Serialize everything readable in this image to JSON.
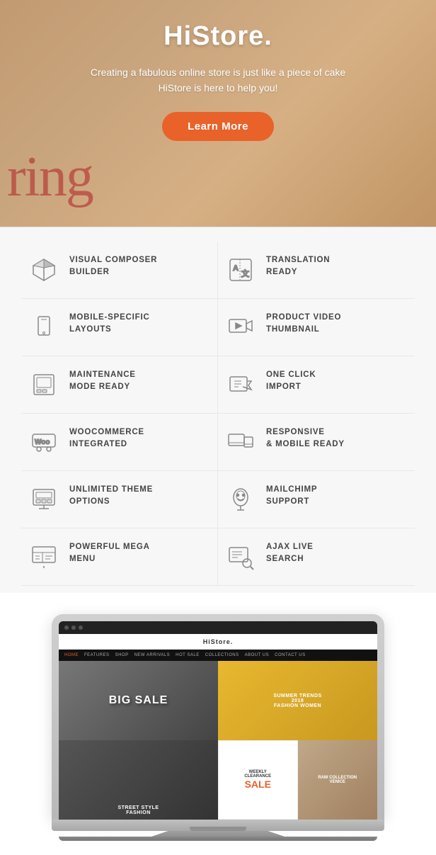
{
  "hero": {
    "title": "HiStore.",
    "subtitle_line1": "Creating a fabulous online store is just like a piece of cake",
    "subtitle_line2": "HiStore is here to help you!",
    "btn_label": "Learn More",
    "handwriting": "ring"
  },
  "features": [
    {
      "id": "visual-composer",
      "label": "VISUAL COMPOSER\nBUILDER",
      "icon": "cube-icon"
    },
    {
      "id": "translation-ready",
      "label": "TRANSLATION\nREADY",
      "icon": "translate-icon"
    },
    {
      "id": "mobile-layouts",
      "label": "MOBILE-SPECIFIC\nLAYOUTS",
      "icon": "mobile-icon"
    },
    {
      "id": "product-video",
      "label": "PRODUCT VIDEO\nTHUMBNAIL",
      "icon": "video-icon"
    },
    {
      "id": "maintenance",
      "label": "MAINTENANCE\nMODE READY",
      "icon": "maintenance-icon"
    },
    {
      "id": "one-click-import",
      "label": "ONE CLICK\nIMPORT",
      "icon": "import-icon"
    },
    {
      "id": "woocommerce",
      "label": "WOOCOMMERCE\nINTEGRATED",
      "icon": "woo-icon"
    },
    {
      "id": "responsive",
      "label": "RESPONSIVE\n& MOBILE READY",
      "icon": "responsive-icon"
    },
    {
      "id": "unlimited-theme",
      "label": "UNLIMITED THEME\nOPTIONS",
      "icon": "theme-icon"
    },
    {
      "id": "mailchimp",
      "label": "MAILCHIMP\nSUPPORT",
      "icon": "mailchimp-icon"
    },
    {
      "id": "mega-menu",
      "label": "POWERFUL MEGA\nMENU",
      "icon": "menu-icon"
    },
    {
      "id": "ajax-search",
      "label": "AJAX LIVE\nSEARCH",
      "icon": "search-icon"
    }
  ],
  "laptop": {
    "brand": "HiStore.",
    "nav_items": [
      "HOME",
      "FEATURES",
      "SHOP",
      "NEW ARRIVALS",
      "HOT SALE",
      "COLLECTIONS",
      "ABOUT US",
      "CONTACT US"
    ],
    "screen": {
      "big_sale": "BIG SALE",
      "street_style": "STREET STYLE\nFASHION",
      "summer_trends": "SUMMER TRENDS\n2018\nFASHION WOMEN",
      "weekly_clearance": "WEEKLY CLEARANCE",
      "sale": "SALE",
      "raw_collection": "RAW COLLECTION\nVENICE"
    }
  },
  "colors": {
    "accent": "#e8622a",
    "feature_text": "#444444",
    "icon_stroke": "#888888"
  }
}
